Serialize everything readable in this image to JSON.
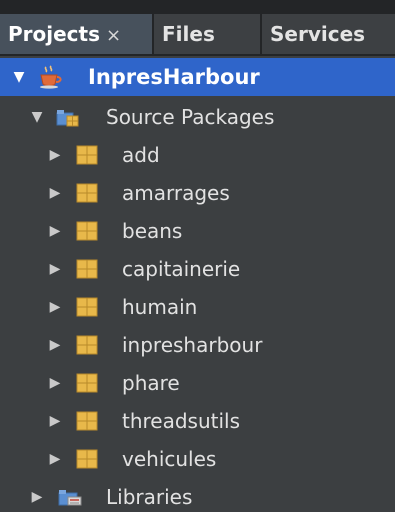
{
  "tabs": [
    {
      "label": "Projects",
      "close": "×",
      "active": true
    },
    {
      "label": "Files"
    },
    {
      "label": "Services"
    }
  ],
  "tree": {
    "project": {
      "label": "InpresHarbour",
      "icon": "coffee-cup-project-icon",
      "expanded": true
    },
    "source_packages": {
      "label": "Source Packages",
      "icon": "source-packages-folder-icon",
      "expanded": true
    },
    "packages": [
      {
        "label": "add"
      },
      {
        "label": "amarrages"
      },
      {
        "label": "beans"
      },
      {
        "label": "capitainerie"
      },
      {
        "label": "humain"
      },
      {
        "label": "inpresharbour"
      },
      {
        "label": "phare"
      },
      {
        "label": "threadsutils"
      },
      {
        "label": "vehicules"
      }
    ],
    "package_icon": "package-icon",
    "libraries": {
      "label": "Libraries",
      "icon": "libraries-folder-icon",
      "expanded": false
    }
  },
  "colors": {
    "selection": "#2f65ca",
    "background": "#3c3f41",
    "tabbar": "#232527",
    "active_tab": "#47515c",
    "package_icon": "#e8b84a"
  }
}
